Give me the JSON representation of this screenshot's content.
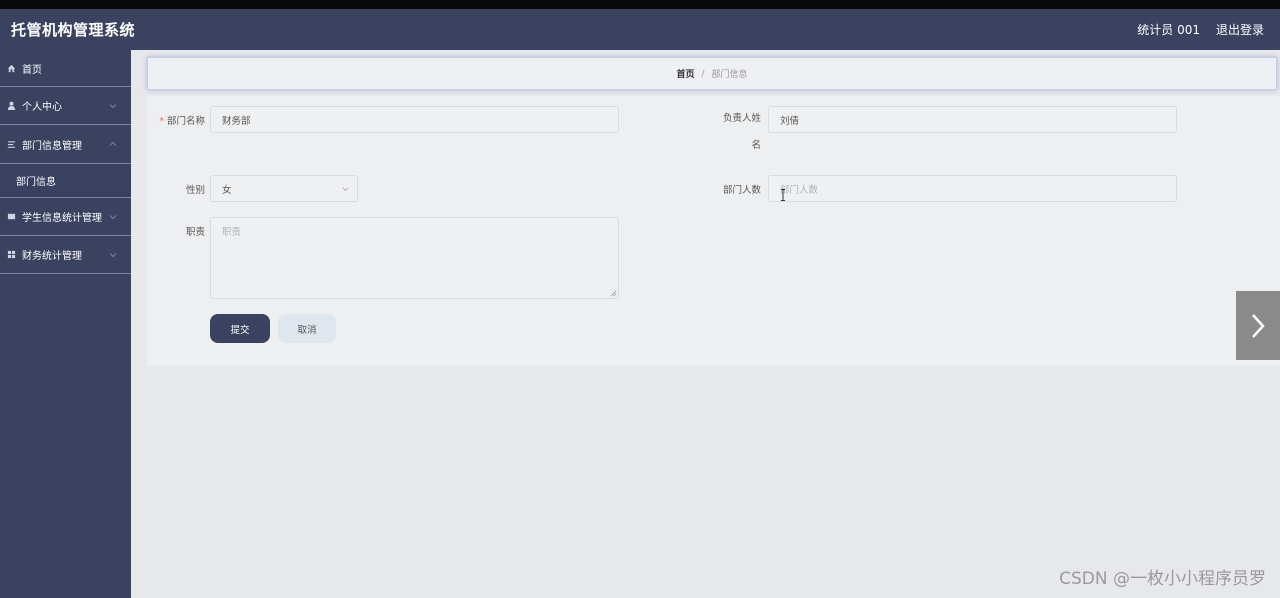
{
  "app": {
    "title": "托管机构管理系统"
  },
  "header": {
    "user": "统计员 001",
    "logout": "退出登录"
  },
  "sidebar": {
    "items": [
      {
        "label": "首页",
        "icon": "home-icon"
      },
      {
        "label": "个人中心",
        "icon": "user-icon"
      },
      {
        "label": "部门信息管理",
        "icon": "list-icon",
        "expanded": true
      },
      {
        "label": "部门信息",
        "icon": ""
      },
      {
        "label": "学生信息统计管理",
        "icon": "table-icon"
      },
      {
        "label": "财务统计管理",
        "icon": "grid-icon"
      }
    ]
  },
  "breadcrumb": {
    "home": "首页",
    "separator": "/",
    "current": "部门信息"
  },
  "form": {
    "dept_name": {
      "label": "部门名称",
      "value": "财务部"
    },
    "manager": {
      "label_line1": "负责人姓",
      "label_line2": "名",
      "value": "刘倩"
    },
    "gender": {
      "label": "性别",
      "value": "女"
    },
    "headcount": {
      "label": "部门人数",
      "placeholder": "部门人数"
    },
    "duty": {
      "label": "职责",
      "placeholder": "职责"
    },
    "submit": "提交",
    "cancel": "取消"
  },
  "watermark": "CSDN @一枚小小程序员罗",
  "colors": {
    "header": "#3a4260",
    "sidebar": "#3a4260",
    "primary_button": "#3a4260",
    "required": "#f56c6c"
  }
}
